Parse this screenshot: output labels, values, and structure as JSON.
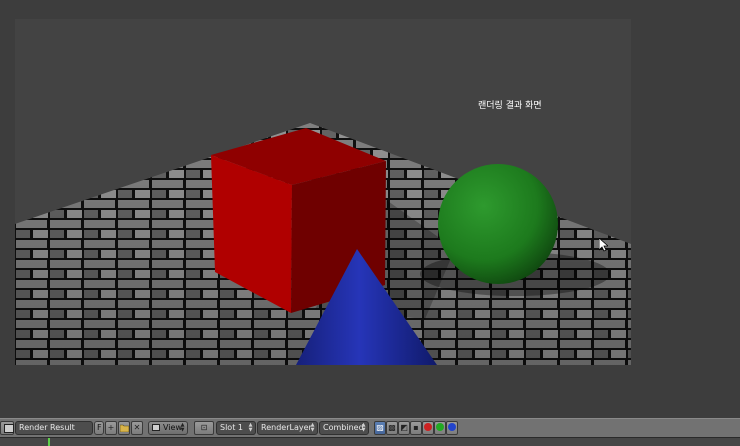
{
  "viewport": {
    "annotation_text": "랜더링 결과 화면"
  },
  "header": {
    "image_name": "Render Result",
    "fake_user_label": "F",
    "view_menu": "View",
    "slot": "Slot 1",
    "render_layer": "RenderLayer",
    "render_pass": "Combined"
  },
  "colors": {
    "cube": "#9b0000",
    "sphere": "#1d7a1d",
    "cone": "#1d2aa6",
    "header": "#727272",
    "timeline_cursor": "#5fd04b"
  },
  "icons": {
    "editor_type": "image-editor-icon",
    "new_image": "plus-icon",
    "open_image": "folder-icon",
    "unlink": "x-icon",
    "pivot": "pivot-icon",
    "channels": [
      "color-alpha-icon",
      "alpha-icon",
      "z-buffer-icon",
      "red-channel-icon",
      "green-channel-icon",
      "blue-channel-icon"
    ],
    "pin": "pin-icon",
    "scopes": "scopes-icon"
  }
}
